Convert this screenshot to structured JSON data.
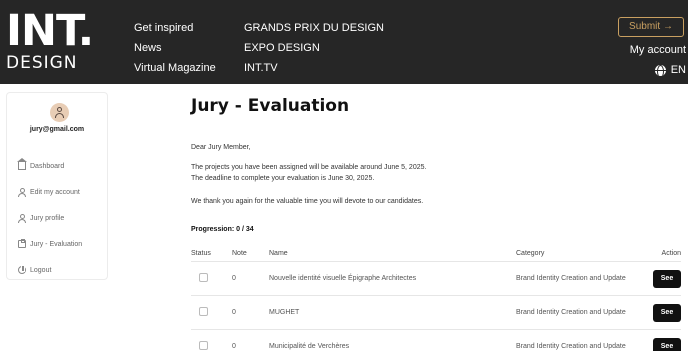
{
  "header": {
    "logo_top": "INT.",
    "logo_bottom": "DESIGN",
    "nav_col1": [
      "Get inspired",
      "News",
      "Virtual Magazine"
    ],
    "nav_col2": [
      "GRANDS PRIX DU DESIGN",
      "EXPO DESIGN",
      "INT.TV"
    ],
    "submit_label": "Submit →",
    "account_label": "My account",
    "language": "EN"
  },
  "sidebar": {
    "email": "jury@gmail.com",
    "items": [
      {
        "label": "Dashboard",
        "icon": "home-icon"
      },
      {
        "label": "Edit my account",
        "icon": "user-icon"
      },
      {
        "label": "Jury profile",
        "icon": "user-icon"
      },
      {
        "label": "Jury - Evaluation",
        "icon": "clipboard-icon"
      },
      {
        "label": "Logout",
        "icon": "power-icon"
      }
    ]
  },
  "main": {
    "title": "Jury - Evaluation",
    "greeting": "Dear Jury Member,",
    "line1": "The projects you have been assigned will be available around June 5, 2025.",
    "line2": "The deadline to complete your evaluation is June 30, 2025.",
    "thanks": "We thank you again for the valuable time you will devote to our candidates.",
    "progression": "Progression: 0 / 34"
  },
  "table": {
    "headers": {
      "status": "Status",
      "note": "Note",
      "name": "Name",
      "category": "Category",
      "action": "Action"
    },
    "rows": [
      {
        "note": "0",
        "name": "Nouvelle identité visuelle Épigraphe Architectes",
        "category": "Brand Identity Creation and Update",
        "action": "See"
      },
      {
        "note": "0",
        "name": "MUGHET",
        "category": "Brand Identity Creation and Update",
        "action": "See"
      },
      {
        "note": "0",
        "name": "Municipalité de Verchères",
        "category": "Brand Identity Creation and Update",
        "action": "See"
      }
    ]
  },
  "colors": {
    "header_bg": "#262626",
    "accent": "#c9a061",
    "button_bg": "#111111"
  }
}
